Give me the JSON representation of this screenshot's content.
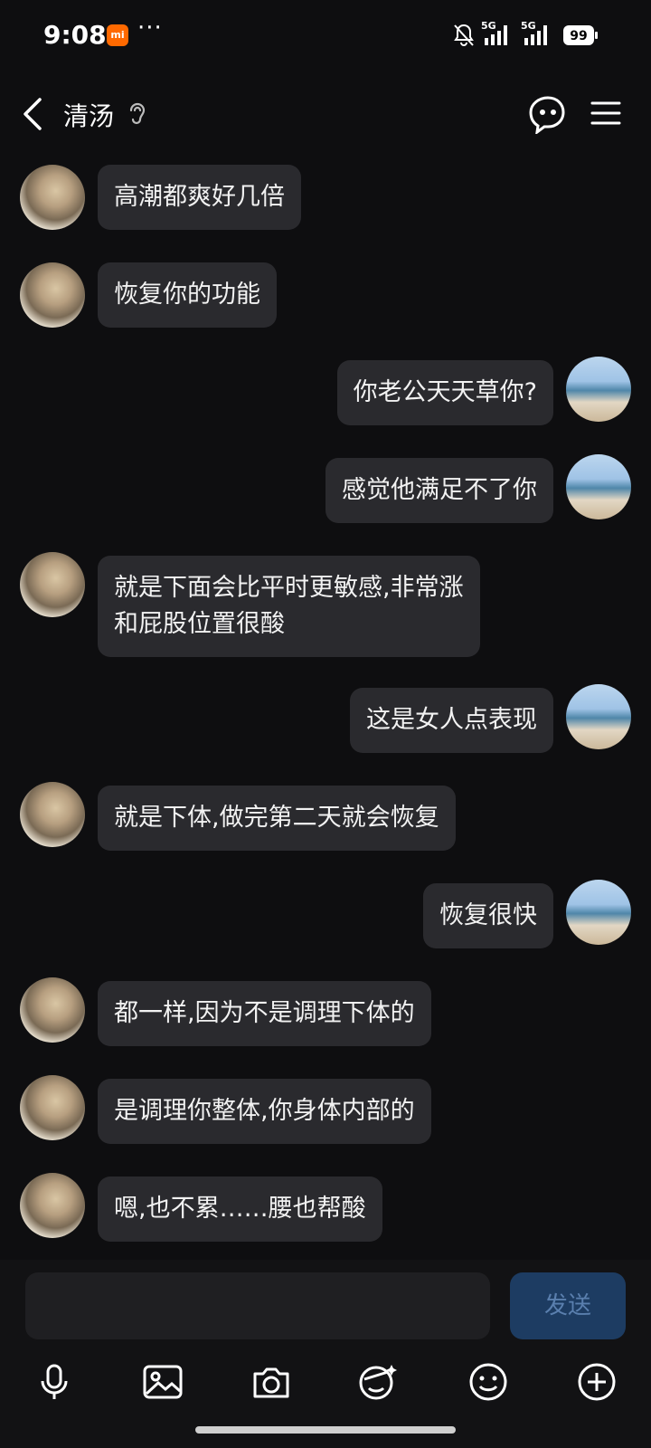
{
  "status_bar": {
    "time": "9:08",
    "app_badge": "mi",
    "more": "···",
    "signal_1_label": "5G",
    "signal_2_label": "5G",
    "battery": "99"
  },
  "header": {
    "title": "清汤",
    "icons": [
      "back-icon",
      "ear-icon",
      "robot-face-icon",
      "menu-icon"
    ]
  },
  "messages": [
    {
      "side": "left",
      "text": "高潮都爽好几倍"
    },
    {
      "side": "left",
      "text": "恢复你的功能"
    },
    {
      "side": "right",
      "text": "你老公天天草你?"
    },
    {
      "side": "right",
      "text": "感觉他满足不了你"
    },
    {
      "side": "left",
      "line1": "就是下面会比平时更敏感,非常涨",
      "line2": "和屁股位置很酸"
    },
    {
      "side": "right",
      "text": "这是女人点表现"
    },
    {
      "side": "left",
      "text": "就是下体,做完第二天就会恢复"
    },
    {
      "side": "right",
      "text": "恢复很快"
    },
    {
      "side": "left",
      "text": "都一样,因为不是调理下体的"
    },
    {
      "side": "left",
      "text": "是调理你整体,你身体内部的"
    },
    {
      "side": "left",
      "text": "嗯,也不累……腰也帮酸"
    }
  ],
  "composer": {
    "input_value": "",
    "send_label": "发送",
    "tools": [
      "microphone-icon",
      "image-icon",
      "camera-icon",
      "sticker-face-icon",
      "emoji-icon",
      "plus-icon"
    ]
  },
  "colors": {
    "background": "#0e0e10",
    "bubble": "#2a2a2e",
    "send_button": "#1d3c62",
    "send_text": "#5a7fae"
  }
}
